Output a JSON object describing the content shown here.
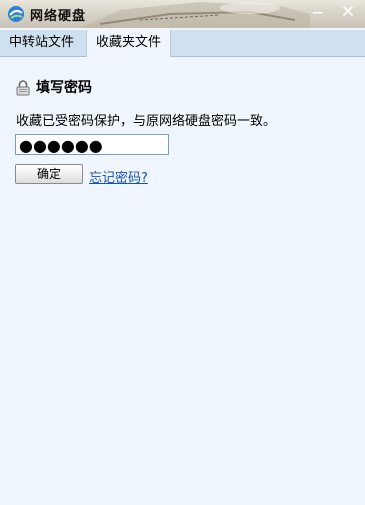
{
  "window": {
    "title": "网络硬盘"
  },
  "tabs": [
    {
      "label": "中转站文件",
      "active": false
    },
    {
      "label": "收藏夹文件",
      "active": true
    }
  ],
  "form": {
    "heading": "填写密码",
    "description": "收藏已受密码保护，与原网络硬盘密码一致。",
    "password_value": "●●●●●●",
    "ok_label": "确定",
    "forgot_label": "忘记密码?"
  },
  "colors": {
    "background": "#f0f6fd",
    "tabbar": "#cfe0f1",
    "link": "#1a4fb6"
  }
}
